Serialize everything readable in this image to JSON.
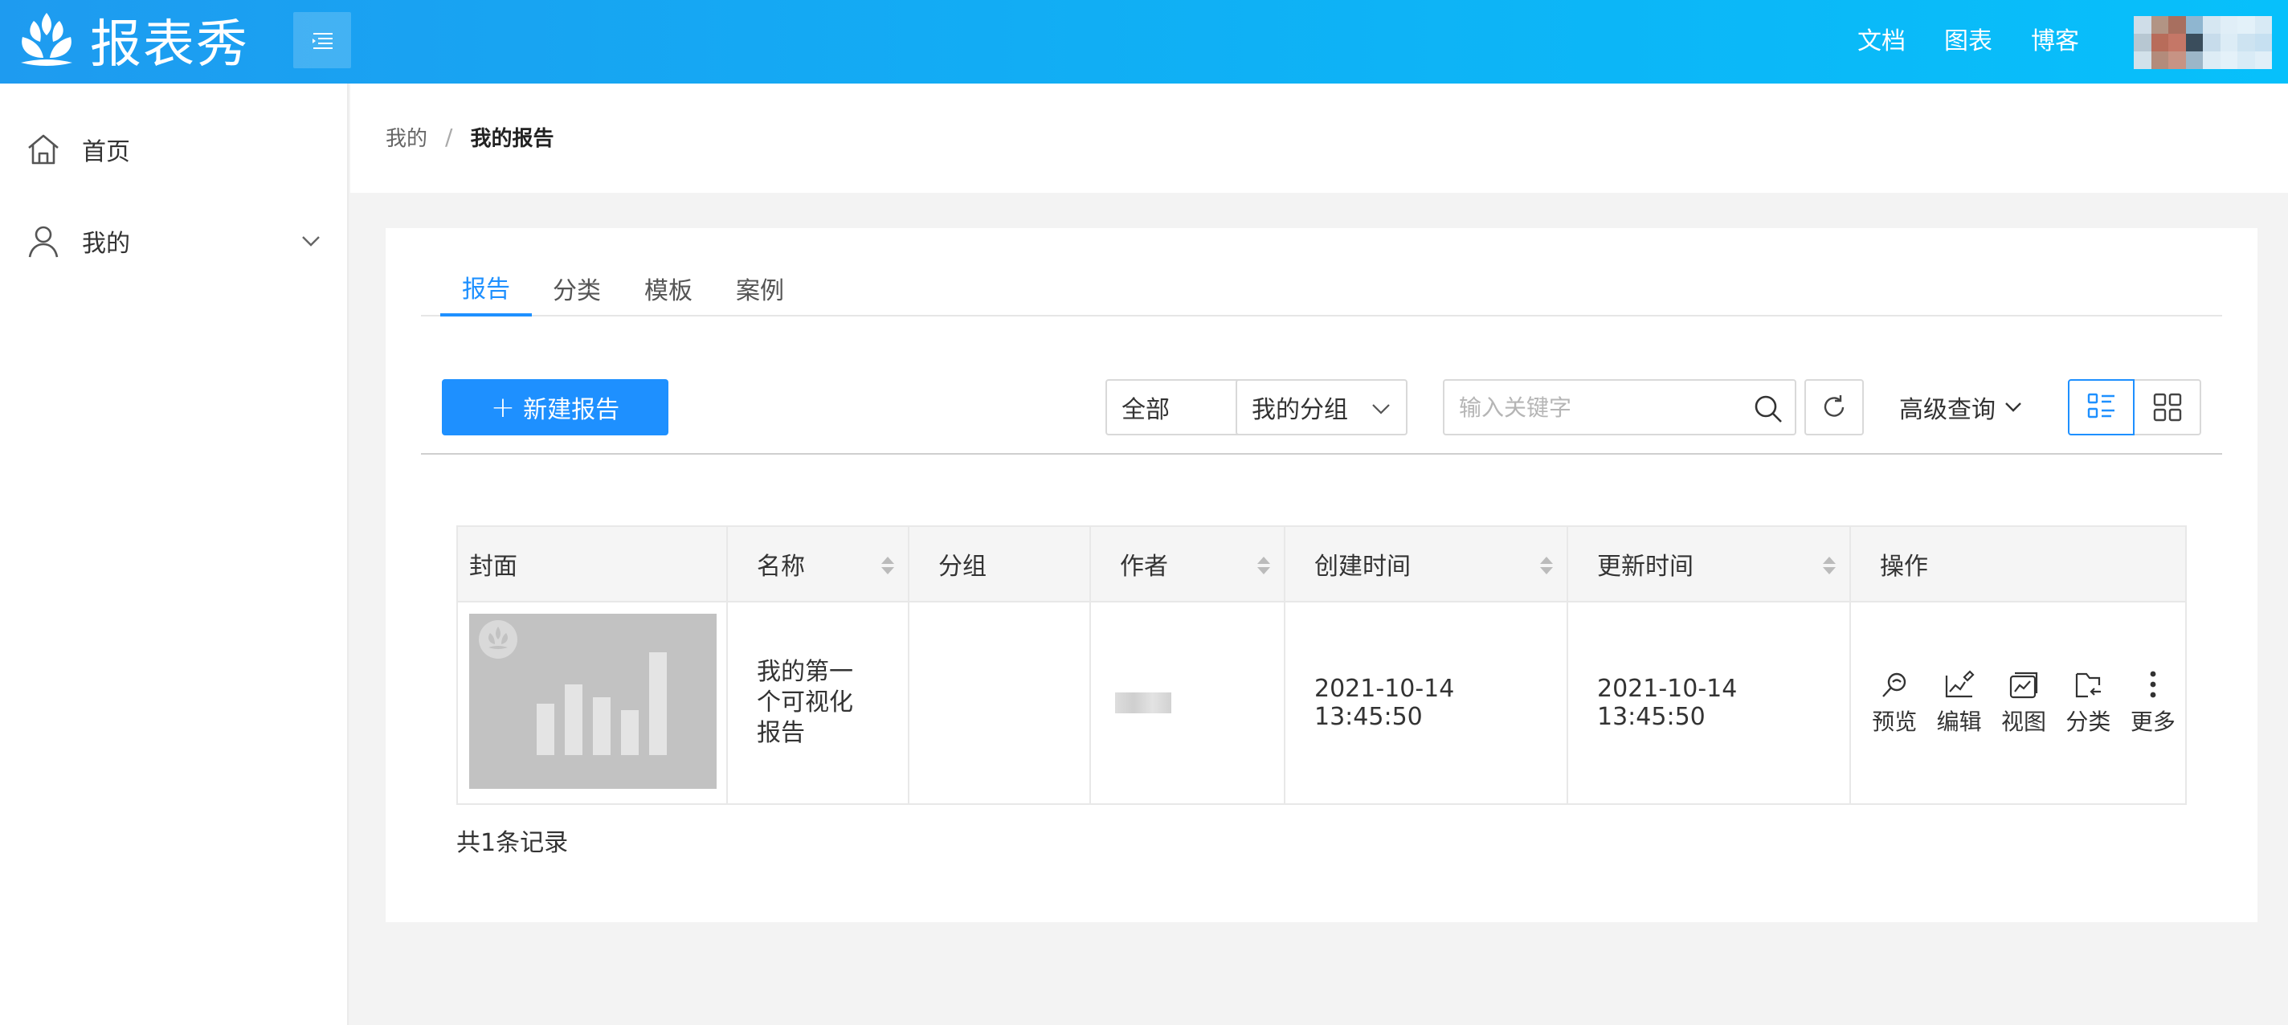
{
  "header": {
    "app_name": "报表秀",
    "nav": [
      "文档",
      "图表",
      "博客"
    ],
    "brand_color": "#1e9bf0"
  },
  "sidebar": {
    "items": [
      {
        "label": "首页",
        "icon": "home-icon"
      },
      {
        "label": "我的",
        "icon": "user-icon",
        "expandable": true
      }
    ]
  },
  "breadcrumb": {
    "parent": "我的",
    "separator": "/",
    "current": "我的报告"
  },
  "tabs": [
    {
      "label": "报告",
      "active": true
    },
    {
      "label": "分类",
      "active": false
    },
    {
      "label": "模板",
      "active": false
    },
    {
      "label": "案例",
      "active": false
    }
  ],
  "toolbar": {
    "new_button": "新建报告",
    "filter_all": "全部",
    "filter_group": "我的分组",
    "search_placeholder": "输入关键字",
    "search_value": "",
    "advanced": "高级查询",
    "view_mode": "list"
  },
  "table": {
    "columns": [
      {
        "label": "封面",
        "sortable": false
      },
      {
        "label": "名称",
        "sortable": true
      },
      {
        "label": "分组",
        "sortable": false
      },
      {
        "label": "作者",
        "sortable": true
      },
      {
        "label": "创建时间",
        "sortable": true
      },
      {
        "label": "更新时间",
        "sortable": true
      },
      {
        "label": "操作",
        "sortable": false
      }
    ],
    "rows": [
      {
        "name": "我的第一个可视化报告",
        "group": "",
        "created": "2021-10-14 13:45:50",
        "updated": "2021-10-14 13:45:50"
      }
    ],
    "actions": [
      "预览",
      "编辑",
      "视图",
      "分类",
      "更多"
    ]
  },
  "footer": {
    "count_text": "共1条记录"
  }
}
